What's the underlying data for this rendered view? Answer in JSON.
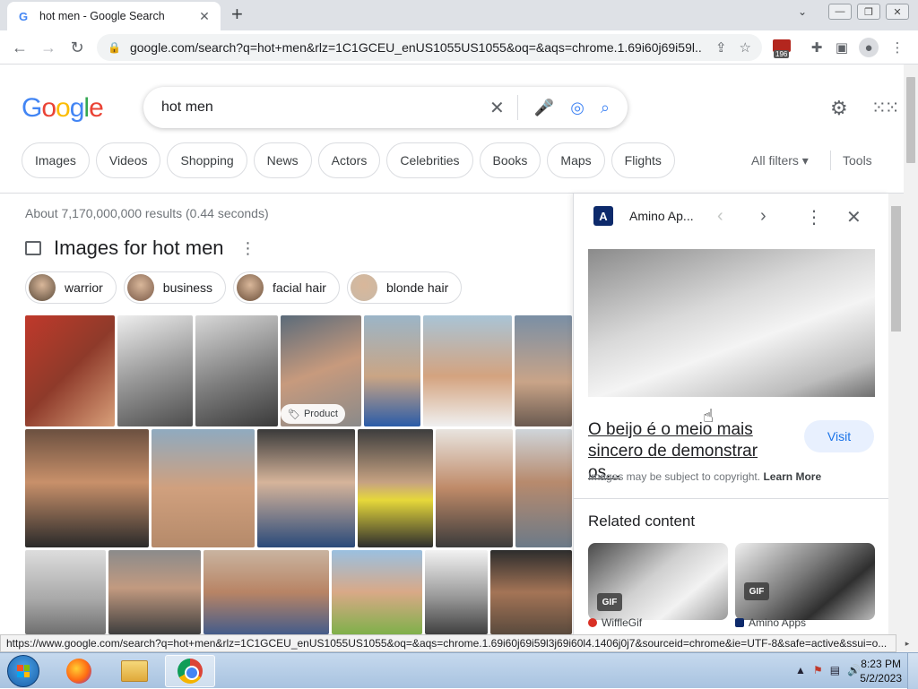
{
  "browser": {
    "tab_title": "hot men - Google Search",
    "tab_favicon": "G",
    "url": "google.com/search?q=hot+men&rlz=1C1GCEU_enUS1055US1055&oq=&aqs=chrome.1.69i60j69i59l...",
    "extension_badge": "196"
  },
  "google": {
    "logo": [
      "G",
      "o",
      "o",
      "g",
      "l",
      "e"
    ],
    "logo_colors": [
      "#4285f4",
      "#ea4335",
      "#fbbc05",
      "#4285f4",
      "#34a853",
      "#ea4335"
    ],
    "query": "hot men",
    "filter_chips": [
      "Images",
      "Videos",
      "Shopping",
      "News",
      "Actors",
      "Celebrities",
      "Books",
      "Maps",
      "Flights"
    ],
    "all_filters": "All filters",
    "tools": "Tools"
  },
  "results": {
    "stats": "About 7,170,000,000 results (0.44 seconds)",
    "images_heading": "Images for hot men",
    "refinements": [
      {
        "label": "warrior",
        "color": "#5a4a3a"
      },
      {
        "label": "business",
        "color": "#7a5a48"
      },
      {
        "label": "facial hair",
        "color": "#6b4f3a"
      },
      {
        "label": "blonde hair",
        "color": "#c9b9a6"
      }
    ],
    "product_tag": "Product"
  },
  "panel": {
    "source_name": "Amino Ap...",
    "source_logo": "A",
    "title": "O beijo é o meio mais sincero de demonstrar os...",
    "visit": "Visit",
    "copyright": "Images may be subject to copyright.",
    "learn_more": "Learn More",
    "related_heading": "Related content",
    "related": [
      {
        "gif": "GIF",
        "source": "WiffleGif"
      },
      {
        "gif": "GIF",
        "source": "Amino Apps"
      }
    ]
  },
  "status_url": "https://www.google.com/search?q=hot+men&rlz=1C1GCEU_enUS1055US1055&oq=&aqs=chrome.1.69i60j69i59l3j69i60l4.1406j0j7&sourceid=chrome&ie=UTF-8&safe=active&ssui=o...",
  "taskbar": {
    "time": "8:23 PM",
    "date": "5/2/2023"
  }
}
